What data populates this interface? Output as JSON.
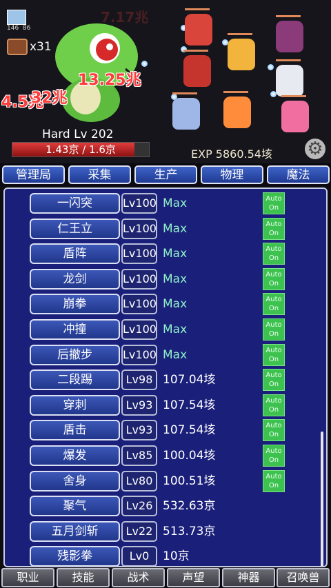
{
  "header": {
    "player_counts": "146  86",
    "chest_count": "x31",
    "faint_damage": [
      "7.17兆",
      "兆"
    ],
    "damage_numbers": [
      "13.25兆",
      "4.5兆",
      "32兆"
    ],
    "stage": "Hard Lv 202",
    "boss_hp": {
      "text": "1.43京 / 1.6京",
      "fraction": 0.894
    },
    "exp": "EXP 5860.54垓",
    "settings_icon": "gear-icon",
    "hero_colors": [
      "#d9453a",
      "#f2b43c",
      "#8b3b7a",
      "#c6352d",
      "#e8eaf2",
      "#9fb7e6",
      "#ff8c3a",
      "#f06fa0"
    ]
  },
  "tabs": [
    "管理局",
    "采集",
    "生产",
    "物理",
    "魔法"
  ],
  "skills": [
    {
      "name": "一闪突",
      "level": "Lv100",
      "value": "Max",
      "auto": true
    },
    {
      "name": "仁王立",
      "level": "Lv100",
      "value": "Max",
      "auto": true
    },
    {
      "name": "盾阵",
      "level": "Lv100",
      "value": "Max",
      "auto": true
    },
    {
      "name": "龙剑",
      "level": "Lv100",
      "value": "Max",
      "auto": true
    },
    {
      "name": "崩拳",
      "level": "Lv100",
      "value": "Max",
      "auto": true
    },
    {
      "name": "冲撞",
      "level": "Lv100",
      "value": "Max",
      "auto": true
    },
    {
      "name": "后撤步",
      "level": "Lv100",
      "value": "Max",
      "auto": true
    },
    {
      "name": "二段踢",
      "level": "Lv98",
      "value": "107.04垓",
      "auto": true
    },
    {
      "name": "穿刺",
      "level": "Lv93",
      "value": "107.54垓",
      "auto": true
    },
    {
      "name": "盾击",
      "level": "Lv93",
      "value": "107.54垓",
      "auto": true
    },
    {
      "name": "爆发",
      "level": "Lv85",
      "value": "100.04垓",
      "auto": true
    },
    {
      "name": "舍身",
      "level": "Lv80",
      "value": "100.51垓",
      "auto": true
    },
    {
      "name": "聚气",
      "level": "Lv26",
      "value": "532.63京",
      "auto": false
    },
    {
      "name": "五月剑斩",
      "level": "Lv22",
      "value": "513.73京",
      "auto": false
    },
    {
      "name": "残影拳",
      "level": "Lv0",
      "value": "10京",
      "auto": false
    }
  ],
  "auto_label": [
    "Auto",
    "On"
  ],
  "bottom_tabs": [
    "职业",
    "技能",
    "战术",
    "声望",
    "神器",
    "召唤兽"
  ]
}
